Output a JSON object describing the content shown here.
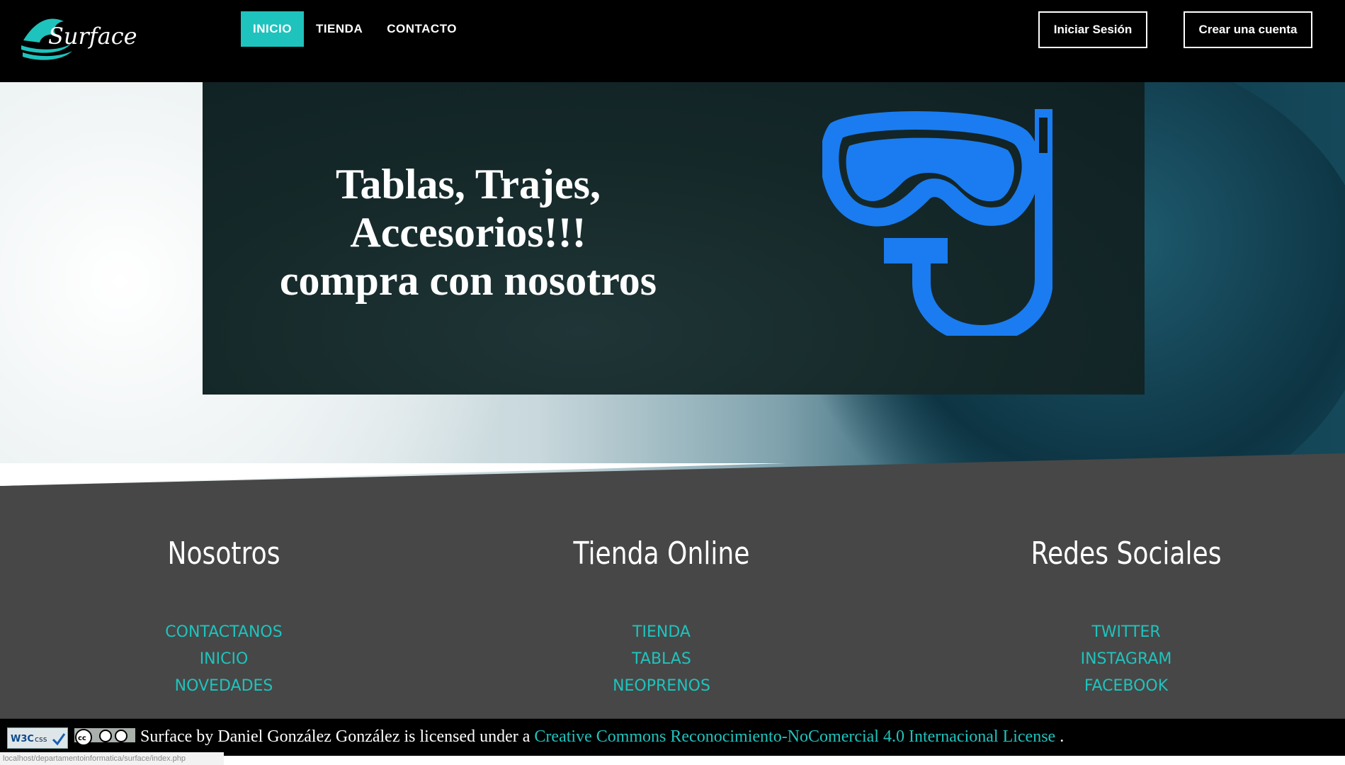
{
  "header": {
    "logo_text": "Surface",
    "nav": [
      {
        "label": "INICIO",
        "active": true
      },
      {
        "label": "TIENDA",
        "active": false
      },
      {
        "label": "CONTACTO",
        "active": false
      }
    ],
    "login_label": "Iniciar Sesión",
    "signup_label": "Crear una cuenta"
  },
  "hero": {
    "title_line1": "Tablas, Trajes, Accesorios!!!",
    "title_line2": "compra con nosotros",
    "icon": "snorkel-mask-icon"
  },
  "footer": {
    "columns": [
      {
        "title": "Nosotros",
        "links": [
          "CONTACTANOS",
          "INICIO",
          "NOVEDADES"
        ]
      },
      {
        "title": "Tienda Online",
        "links": [
          "TIENDA",
          "TABLAS",
          "NEOPRENOS"
        ]
      },
      {
        "title": "Redes Sociales",
        "links": [
          "TWITTER",
          "INSTAGRAM",
          "FACEBOOK"
        ]
      }
    ]
  },
  "license": {
    "prefix": "Surface by Daniel González González is licensed under a ",
    "link": "Creative Commons Reconocimiento-NoComercial 4.0 Internacional License",
    "suffix": ".",
    "w3c_badge": "W3C css",
    "cc_badge": "cc by nc"
  },
  "status_url": "localhost/departamentoinformatica/surface/index.php",
  "colors": {
    "accent": "#1fc3bd",
    "header_bg": "#000000",
    "footer_bg": "#474747",
    "icon_blue": "#1a7cf0"
  }
}
